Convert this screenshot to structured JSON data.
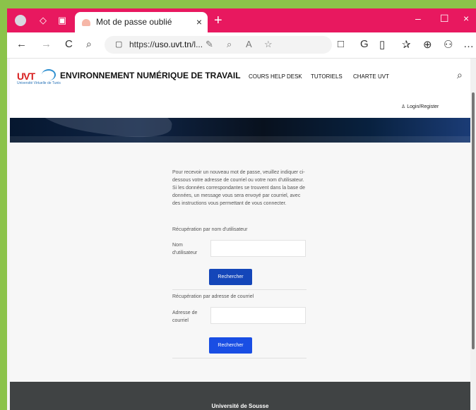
{
  "browser": {
    "tab_title": "Mot de passe oublié",
    "tab_close": "×",
    "new_tab": "+",
    "url_prefix": "https://",
    "url_domain": "uso.uvt.tn",
    "url_suffix": "/l...",
    "window_controls": [
      "–",
      "☐",
      "×"
    ],
    "tools": [
      "←",
      "→",
      "C",
      "⌕",
      "⇩",
      "A",
      "☆",
      "□",
      "G",
      "▯",
      "✰",
      "⊕",
      "⚇",
      "…"
    ]
  },
  "site": {
    "logo": "UVT",
    "logo_sub": "Université Virtuelle de Tunis",
    "title": "ENVIRONNEMENT NUMÉRIQUE DE TRAVAIL",
    "nav": [
      "COURS",
      "HELP DESK",
      "TUTORIELS",
      "CHARTE UVT"
    ],
    "search_icon": "⌕",
    "login_icon": "♙",
    "login": "Login/Register"
  },
  "form": {
    "intro": "Pour recevoir un nouveau mot de passe, veuillez indiquer ci-dessous votre adresse de courriel ou votre nom d'utilisateur. Si les données correspondantes se trouvent dans la base de données, un message vous sera envoyé par courriel, avec des instructions vous permettant de vous connecter.",
    "username_section": "Récupération par nom d'utilisateur",
    "username_label": "Nom d'utilisateur",
    "username_value": "",
    "button_search": "Rechercher",
    "email_section": "Récupération par adresse de courriel",
    "email_label": "Adresse de courriel",
    "email_value": ""
  },
  "footer": {
    "title": "Université de Sousse"
  },
  "colors": {
    "tabbar": "#e8185f",
    "button": "#1446b9",
    "footer": "#404344"
  }
}
